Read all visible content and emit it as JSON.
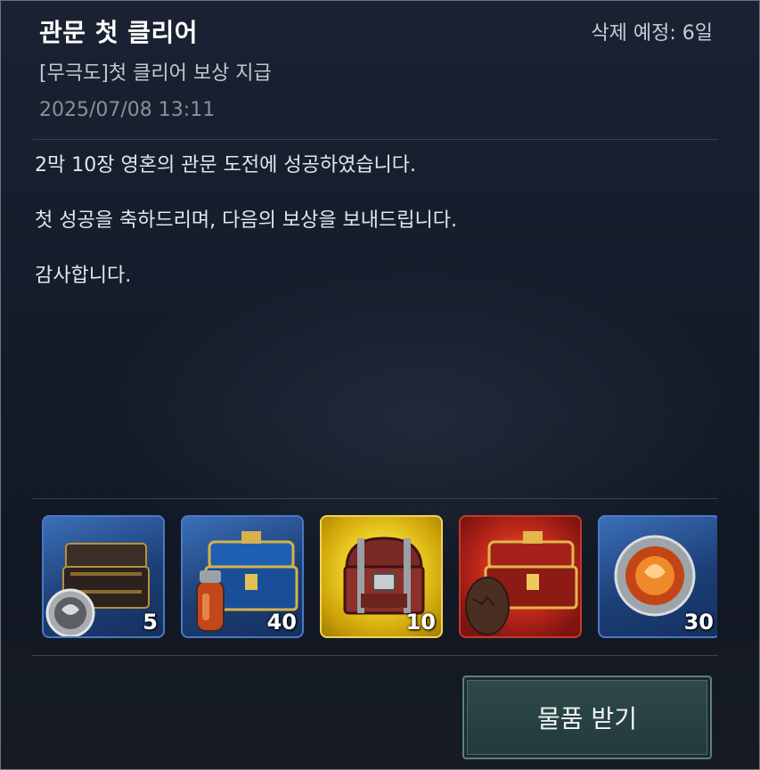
{
  "mail": {
    "title": "관문 첫 클리어",
    "delete_info": "삭제 예정: 6일",
    "sender": "[무극도]첫 클리어 보상 지급",
    "date": "2025/07/08 13:11",
    "body": [
      "2막 10장 영혼의 관문 도전에 성공하였습니다.",
      "첫 성공을 축하드리며, 다음의 보상을 보내드립니다.",
      "감사합니다."
    ]
  },
  "rewards": [
    {
      "name": "dark-chest-with-coin",
      "qty": "5",
      "frame": "blue"
    },
    {
      "name": "blue-chest-with-potion",
      "qty": "40",
      "frame": "blue"
    },
    {
      "name": "red-treasure-chest",
      "qty": "10",
      "frame": "gold"
    },
    {
      "name": "red-chest-with-egg",
      "qty": "",
      "frame": "red"
    },
    {
      "name": "fire-orb",
      "qty": "30",
      "frame": "blue"
    }
  ],
  "actions": {
    "receive_label": "물품 받기"
  },
  "colors": {
    "background": "#141b29",
    "blue_frame": "#4a79c6",
    "gold_frame": "#f1d45a",
    "red_frame": "#c23a2c",
    "button_bg": "#2f4a4c"
  }
}
